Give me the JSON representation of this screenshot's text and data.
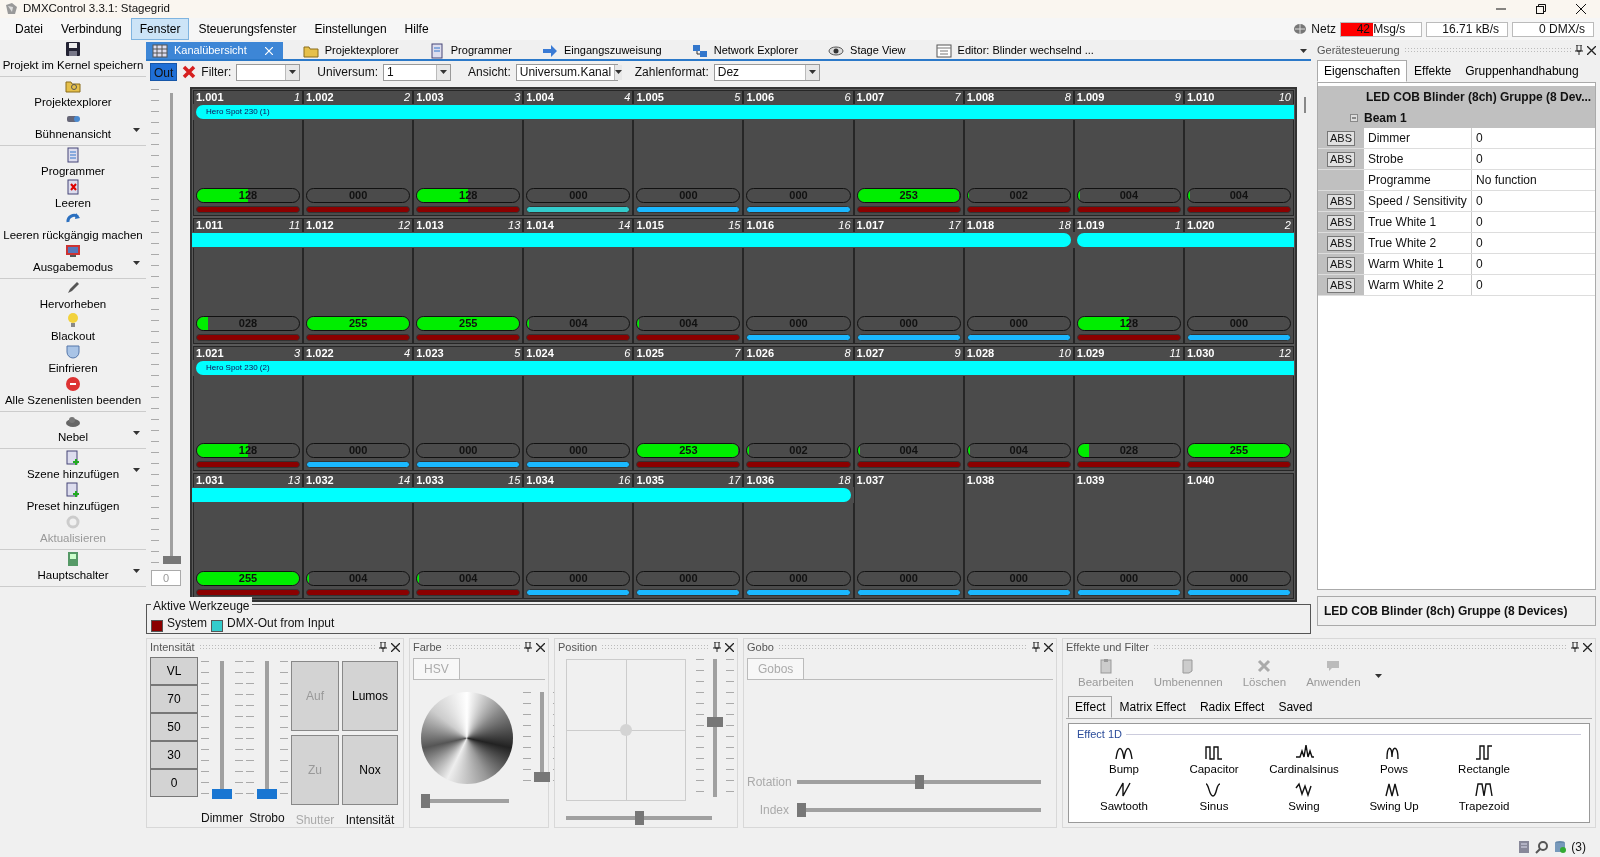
{
  "window": {
    "title": "DMXControl 3.3.1: Stagegrid"
  },
  "menu": [
    {
      "label": "Datei",
      "selected": false
    },
    {
      "label": "Verbindung",
      "selected": false
    },
    {
      "label": "Fenster",
      "selected": true
    },
    {
      "label": "Steuerungsfenster",
      "selected": false
    },
    {
      "label": "Einstellungen",
      "selected": false
    },
    {
      "label": "Hilfe",
      "selected": false
    }
  ],
  "network": {
    "label": "Netz",
    "meter": {
      "text": "42 Msg/s",
      "level": 0.4
    },
    "readings": [
      "16.71 kB/s",
      "0 DMX/s"
    ]
  },
  "sidebar": {
    "groups": [
      {
        "items": [
          {
            "label": "Projekt im Kernel speichern",
            "dropdown": false,
            "disabled": false
          }
        ]
      },
      {
        "items": [
          {
            "label": "Projektexplorer",
            "dropdown": false,
            "disabled": false
          },
          {
            "label": "Bühnenansicht",
            "dropdown": true,
            "disabled": false
          }
        ]
      },
      {
        "items": [
          {
            "label": "Programmer",
            "dropdown": false,
            "disabled": false
          },
          {
            "label": "Leeren",
            "dropdown": false,
            "disabled": false
          },
          {
            "label": "Leeren rückgängig machen",
            "dropdown": false,
            "disabled": false
          },
          {
            "label": "Ausgabemodus",
            "dropdown": true,
            "disabled": false
          }
        ]
      },
      {
        "items": [
          {
            "label": "Hervorheben",
            "dropdown": false,
            "disabled": false
          },
          {
            "label": "Blackout",
            "dropdown": false,
            "disabled": false
          },
          {
            "label": "Einfrieren",
            "dropdown": false,
            "disabled": false
          },
          {
            "label": "Alle Szenenlisten beenden",
            "dropdown": false,
            "disabled": false
          }
        ]
      },
      {
        "items": [
          {
            "label": "Nebel",
            "dropdown": true,
            "disabled": false
          }
        ]
      },
      {
        "items": [
          {
            "label": "Szene hinzufügen",
            "dropdown": true,
            "disabled": false
          },
          {
            "label": "Preset hinzufügen",
            "dropdown": false,
            "disabled": false
          },
          {
            "label": "Aktualisieren",
            "dropdown": false,
            "disabled": true
          }
        ]
      },
      {
        "items": [
          {
            "label": "Hauptschalter",
            "dropdown": true,
            "disabled": false
          }
        ]
      }
    ]
  },
  "tabs": [
    {
      "label": "Kanalübersicht",
      "selected": true,
      "closable": true
    },
    {
      "label": "Projektexplorer",
      "selected": false,
      "closable": false
    },
    {
      "label": "Programmer",
      "selected": false,
      "closable": false
    },
    {
      "label": "Eingangszuweisung",
      "selected": false,
      "closable": false
    },
    {
      "label": "Network Explorer",
      "selected": false,
      "closable": false
    },
    {
      "label": "Stage View",
      "selected": false,
      "closable": false
    },
    {
      "label": "Editor: Blinder wechselnd ...",
      "selected": false,
      "closable": false
    }
  ],
  "toolbar": {
    "out_button": {
      "label": "Out",
      "on": true
    },
    "fields": [
      {
        "label": "Filter:"
      },
      {
        "label": "Universum:",
        "value": "1"
      },
      {
        "label": "Ansicht:",
        "value": "Universum.Kanal"
      },
      {
        "label": "Zahlenformat:",
        "value": "Dez"
      }
    ]
  },
  "master_fader": {
    "level": 0,
    "value": "0"
  },
  "grid": {
    "rows": [
      {
        "segments": [
          {
            "kind": "device",
            "label": "Hero Spot 230 (1)",
            "continues_left": false,
            "continues_right": true,
            "channels": [
              {
                "address": "1.001",
                "number": "1",
                "value": "128",
                "level": 0.5,
                "color": "#8b0000"
              },
              {
                "address": "1.002",
                "number": "2",
                "value": "000",
                "level": 0,
                "color": "#8b0000"
              },
              {
                "address": "1.003",
                "number": "3",
                "value": "128",
                "level": 0.5,
                "color": "#8b0000"
              },
              {
                "address": "1.004",
                "number": "4",
                "value": "000",
                "level": 0,
                "color": "#33cccc"
              },
              {
                "address": "1.005",
                "number": "5",
                "value": "000",
                "level": 0,
                "color": "#1ab8ff"
              },
              {
                "address": "1.006",
                "number": "6",
                "value": "000",
                "level": 0,
                "color": "#1ab8ff"
              },
              {
                "address": "1.007",
                "number": "7",
                "value": "253",
                "level": 0.99,
                "color": "#8b0000"
              },
              {
                "address": "1.008",
                "number": "8",
                "value": "002",
                "level": 0.01,
                "color": "#8b0000"
              },
              {
                "address": "1.009",
                "number": "9",
                "value": "004",
                "level": 0.02,
                "color": "#8b0000"
              },
              {
                "address": "1.010",
                "number": "10",
                "value": "004",
                "level": 0.02,
                "color": "#8b0000"
              }
            ]
          }
        ]
      },
      {
        "segments": [
          {
            "kind": "device",
            "continues_left": true,
            "continues_right": false,
            "channels": [
              {
                "address": "1.011",
                "number": "11",
                "value": "028",
                "level": 0.11,
                "color": "#8b0000"
              },
              {
                "address": "1.012",
                "number": "12",
                "value": "255",
                "level": 1,
                "color": "#8b0000"
              },
              {
                "address": "1.013",
                "number": "13",
                "value": "255",
                "level": 1,
                "color": "#8b0000"
              },
              {
                "address": "1.014",
                "number": "14",
                "value": "004",
                "level": 0.02,
                "color": "#8b0000"
              },
              {
                "address": "1.015",
                "number": "15",
                "value": "004",
                "level": 0.02,
                "color": "#8b0000"
              },
              {
                "address": "1.016",
                "number": "16",
                "value": "000",
                "level": 0,
                "color": "#1ab8ff"
              },
              {
                "address": "1.017",
                "number": "17",
                "value": "000",
                "level": 0,
                "color": "#1ab8ff"
              },
              {
                "address": "1.018",
                "number": "18",
                "value": "000",
                "level": 0,
                "color": "#1ab8ff"
              }
            ]
          },
          {
            "kind": "device",
            "continues_left": false,
            "continues_right": true,
            "channels": [
              {
                "address": "1.019",
                "number": "1",
                "value": "128",
                "level": 0.5,
                "color": "#8b0000"
              },
              {
                "address": "1.020",
                "number": "2",
                "value": "000",
                "level": 0,
                "color": "#1ab8ff"
              }
            ]
          }
        ]
      },
      {
        "segments": [
          {
            "kind": "device",
            "label": "Hero Spot 230 (2)",
            "continues_left": false,
            "continues_right": true,
            "channels": [
              {
                "address": "1.021",
                "number": "3",
                "value": "128",
                "level": 0.5,
                "color": "#8b0000"
              },
              {
                "address": "1.022",
                "number": "4",
                "value": "000",
                "level": 0,
                "color": "#1ab8ff"
              },
              {
                "address": "1.023",
                "number": "5",
                "value": "000",
                "level": 0,
                "color": "#1ab8ff"
              },
              {
                "address": "1.024",
                "number": "6",
                "value": "000",
                "level": 0,
                "color": "#1ab8ff"
              },
              {
                "address": "1.025",
                "number": "7",
                "value": "253",
                "level": 0.99,
                "color": "#8b0000"
              },
              {
                "address": "1.026",
                "number": "8",
                "value": "002",
                "level": 0.01,
                "color": "#8b0000"
              },
              {
                "address": "1.027",
                "number": "9",
                "value": "004",
                "level": 0.02,
                "color": "#8b0000"
              },
              {
                "address": "1.028",
                "number": "10",
                "value": "004",
                "level": 0.02,
                "color": "#8b0000"
              },
              {
                "address": "1.029",
                "number": "11",
                "value": "028",
                "level": 0.11,
                "color": "#8b0000"
              },
              {
                "address": "1.030",
                "number": "12",
                "value": "255",
                "level": 1,
                "color": "#8b0000"
              }
            ]
          }
        ]
      },
      {
        "segments": [
          {
            "kind": "device",
            "continues_left": true,
            "continues_right": false,
            "channels": [
              {
                "address": "1.031",
                "number": "13",
                "value": "255",
                "level": 1,
                "color": "#8b0000"
              },
              {
                "address": "1.032",
                "number": "14",
                "value": "004",
                "level": 0.02,
                "color": "#8b0000"
              },
              {
                "address": "1.033",
                "number": "15",
                "value": "004",
                "level": 0.02,
                "color": "#8b0000"
              },
              {
                "address": "1.034",
                "number": "16",
                "value": "000",
                "level": 0,
                "color": "#1ab8ff"
              },
              {
                "address": "1.035",
                "number": "17",
                "value": "000",
                "level": 0,
                "color": "#1ab8ff"
              },
              {
                "address": "1.036",
                "number": "18",
                "value": "000",
                "level": 0,
                "color": "#1ab8ff"
              }
            ]
          },
          {
            "kind": "free",
            "channels": [
              {
                "address": "1.037",
                "value": "000",
                "level": 0,
                "color": "#1ab8ff"
              },
              {
                "address": "1.038",
                "value": "000",
                "level": 0,
                "color": "#1ab8ff"
              },
              {
                "address": "1.039",
                "value": "000",
                "level": 0,
                "color": "#1ab8ff"
              },
              {
                "address": "1.040",
                "value": "000",
                "level": 0,
                "color": "#1ab8ff"
              }
            ]
          }
        ]
      }
    ]
  },
  "legend": {
    "title": "Aktive Werkzeuge",
    "items": [
      {
        "label": "System",
        "color": "#8b0000"
      },
      {
        "label": "DMX-Out from Input",
        "color": "#33cccc"
      }
    ]
  },
  "device_panel": {
    "title": "Gerätesteuerung",
    "tabs": [
      {
        "label": "Eigenschaften",
        "selected": true
      },
      {
        "label": "Effekte",
        "selected": false
      },
      {
        "label": "Gruppenhandhabung",
        "selected": false
      }
    ],
    "header": "LED COB Blinder (8ch) Gruppe (8 Dev...",
    "category": {
      "label": "Beam 1",
      "expanded": true,
      "properties": [
        {
          "abs": "ABS",
          "name": "Dimmer",
          "value": "0"
        },
        {
          "abs": "ABS",
          "name": "Strobe",
          "value": "0"
        },
        {
          "name": "Programme",
          "value": "No function"
        },
        {
          "abs": "ABS",
          "name": "Speed / Sensitivity",
          "value": "0"
        },
        {
          "abs": "ABS",
          "name": "True White 1",
          "value": "0"
        },
        {
          "abs": "ABS",
          "name": "True White 2",
          "value": "0"
        },
        {
          "abs": "ABS",
          "name": "Warm White 1",
          "value": "0"
        },
        {
          "abs": "ABS",
          "name": "Warm White 2",
          "value": "0"
        }
      ]
    },
    "description": "LED COB Blinder (8ch) Gruppe (8 Devices)"
  },
  "intensity_panel": {
    "title": "Intensität",
    "presets": [
      "VL",
      "70",
      "50",
      "30",
      "0"
    ],
    "faders": [
      {
        "label": "Dimmer",
        "level": 0
      },
      {
        "label": "Strobo",
        "level": 0
      }
    ],
    "button_groups": [
      {
        "label": "Shutter",
        "disabled": true,
        "buttons": [
          {
            "label": "Auf",
            "disabled": true
          },
          {
            "label": "Zu",
            "disabled": true
          }
        ]
      },
      {
        "label": "Intensität",
        "disabled": false,
        "buttons": [
          {
            "label": "Lumos",
            "disabled": false
          },
          {
            "label": "Nox",
            "disabled": false
          }
        ]
      }
    ]
  },
  "color_panel": {
    "title": "Farbe",
    "tabs": [
      {
        "label": "HSV",
        "selected": true
      }
    ],
    "saturation": {
      "level": 0
    },
    "brightness": {
      "level": 0
    }
  },
  "position_panel": {
    "title": "Position",
    "tilt": {
      "level": 0.55
    },
    "pan": {
      "level": 0.5
    }
  },
  "gobo_panel": {
    "title": "Gobo",
    "tabs": [
      {
        "label": "Gobos",
        "selected": true
      }
    ],
    "sliders": [
      {
        "label": "Rotation",
        "level": 0.5
      },
      {
        "label": "Index",
        "level": 0
      }
    ]
  },
  "effects_panel": {
    "title": "Effekte und Filter",
    "actions": [
      {
        "label": "Bearbeiten",
        "disabled": true
      },
      {
        "label": "Umbenennen",
        "disabled": true
      },
      {
        "label": "Löschen",
        "disabled": true
      },
      {
        "label": "Anwenden",
        "disabled": true
      }
    ],
    "tabs": [
      {
        "label": "Effect",
        "selected": true
      },
      {
        "label": "Matrix Effect",
        "selected": false
      },
      {
        "label": "Radix Effect",
        "selected": false
      },
      {
        "label": "Saved",
        "selected": false
      }
    ],
    "group": "Effect 1D",
    "effects": [
      "Bump",
      "Capacitor",
      "Cardinalsinus",
      "Pows",
      "Rectangle",
      "Sawtooth",
      "Sinus",
      "Swing",
      "Swing Up",
      "Trapezoid"
    ]
  },
  "status_bar": {
    "text": "(3)"
  }
}
